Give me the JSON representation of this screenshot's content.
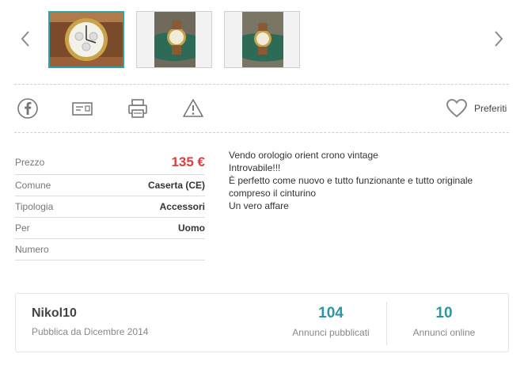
{
  "gallery": {
    "thumbnails": [
      {
        "alt": "watch-thumbnail-1",
        "active": true
      },
      {
        "alt": "watch-thumbnail-2",
        "active": false
      },
      {
        "alt": "watch-thumbnail-3",
        "active": false
      }
    ],
    "prev_icon": "chevron-left-icon",
    "next_icon": "chevron-right-icon"
  },
  "actions": {
    "icons": [
      "facebook-icon",
      "email-icon",
      "print-icon",
      "report-icon"
    ],
    "favorite_label": "Preferiti",
    "favorite_icon": "heart-icon"
  },
  "details": {
    "rows": [
      {
        "key": "Prezzo",
        "value": "135 €"
      },
      {
        "key": "Comune",
        "value": "Caserta (CE)"
      },
      {
        "key": "Tipologia",
        "value": "Accessori"
      },
      {
        "key": "Per",
        "value": "Uomo"
      },
      {
        "key": "Numero",
        "value": ""
      }
    ]
  },
  "description": {
    "lines": [
      "Vendo orologio orient crono vintage",
      "Introvabile!!!",
      "È perfetto come nuovo e tutto funzionante e tutto originale",
      "compreso il cinturino",
      "Un vero affare"
    ]
  },
  "seller": {
    "name": "Nikol10",
    "since": "Pubblica da Dicembre 2014",
    "published_count": "104",
    "published_label": "Annunci pubblicati",
    "online_count": "10",
    "online_label": "Annunci online"
  },
  "colors": {
    "accent": "#2fa3a8",
    "price": "#e03c3c",
    "stat_number": "#2b97a2"
  }
}
